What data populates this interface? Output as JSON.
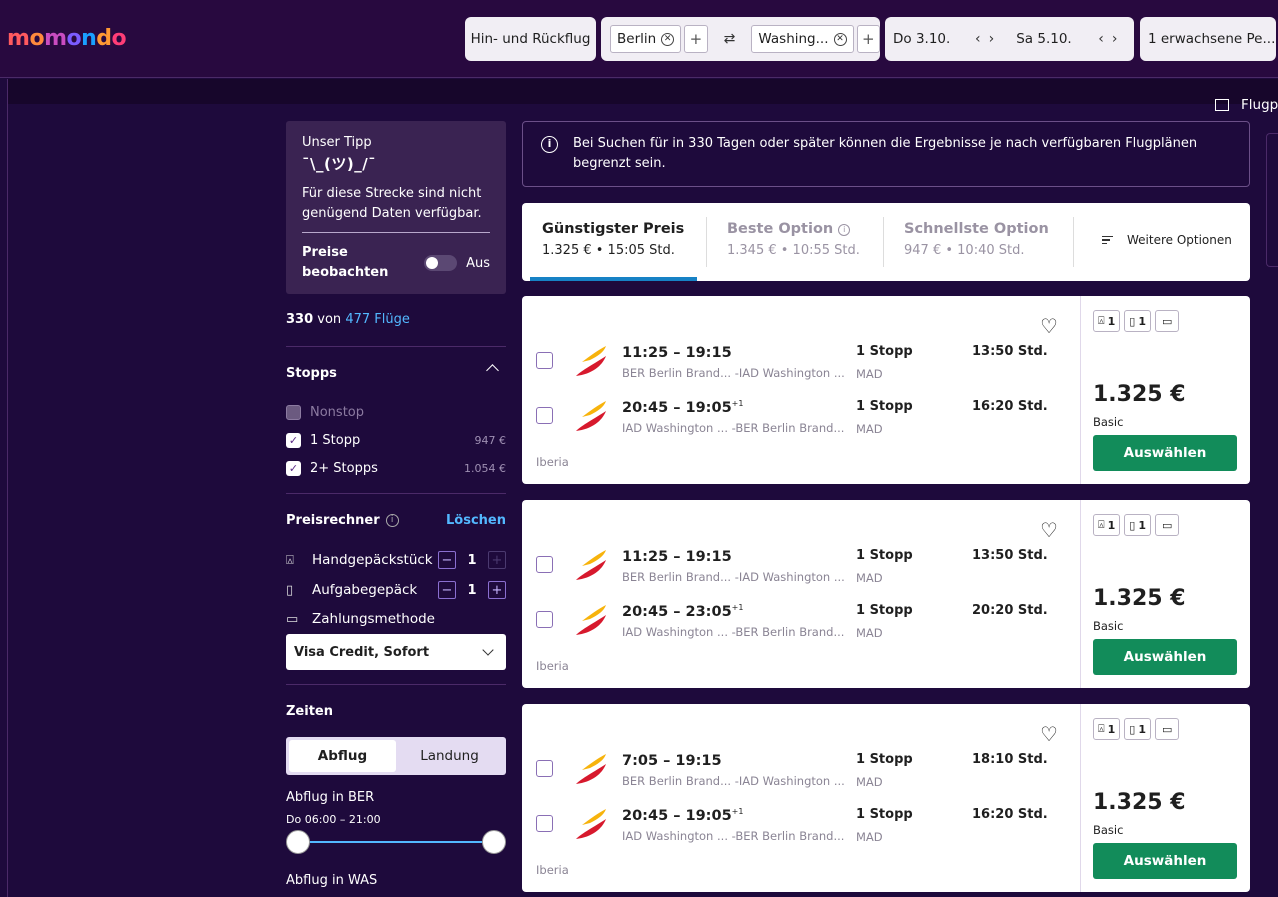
{
  "brand": {
    "logo_text": "momondo",
    "logo_colors": [
      "#ff5a5f",
      "#ff8a3d",
      "#c94cc0",
      "#7b5cff",
      "#1aa0ff",
      "#ff9933",
      "#ff3d77"
    ]
  },
  "search": {
    "trip_type": "Hin- und Rückflug",
    "origin": "Berlin",
    "destination": "Washing...",
    "swap_icon": "⇄",
    "date_out": "Do 3.10.",
    "date_back": "Sa 5.10.",
    "passengers": "1 erwachsene Pe..."
  },
  "side_link": "Flugp",
  "tip": {
    "title": "Unser Tipp",
    "shrug": "¯\\_(ツ)_/¯",
    "text": "Für diese Strecke sind nicht genügend Daten verfügbar.",
    "watch_label": "Preise beobachten",
    "toggle_state": "Aus"
  },
  "results_count": {
    "shown": "330",
    "of": "von",
    "total": "477 Flüge"
  },
  "stops": {
    "heading": "Stopps",
    "options": [
      {
        "label": "Nonstop",
        "price": "",
        "checked": false,
        "disabled": true
      },
      {
        "label": "1 Stopp",
        "price": "947 €",
        "checked": true,
        "disabled": false
      },
      {
        "label": "2+ Stopps",
        "price": "1.054 €",
        "checked": true,
        "disabled": false
      }
    ]
  },
  "price_calc": {
    "heading": "Preisrechner",
    "clear": "Löschen",
    "carry_on_label": "Handgepäckstück",
    "carry_on_value": "1",
    "checked_label": "Aufgabegepäck",
    "checked_value": "1",
    "payment_label": "Zahlungsmethode",
    "payment_value": "Visa Credit, Sofort"
  },
  "times": {
    "heading": "Zeiten",
    "tab_departure": "Abflug",
    "tab_arrival": "Landung",
    "dep_ber_label": "Abflug in BER",
    "dep_ber_range": "Do 06:00 – 21:00",
    "dep_was_label": "Abflug in WAS"
  },
  "notice": "Bei Suchen für in 330 Tagen oder später können die Ergebnisse je nach verfügbaren Flugplänen begrenzt sein.",
  "sort": {
    "cheapest_label": "Günstigster Preis",
    "cheapest_value": "1.325 € • 15:05 Std.",
    "best_label": "Beste Option",
    "best_value": "1.345 € • 10:55 Std.",
    "fastest_label": "Schnellste Option",
    "fastest_value": "947 € • 10:40 Std.",
    "more_label": "Weitere Optionen"
  },
  "results": [
    {
      "legs": [
        {
          "times": "11:25 – 19:15",
          "plus": "",
          "route": "BER Berlin Brand... -IAD Washington ...",
          "stops": "1 Stopp",
          "via": "MAD",
          "duration": "13:50 Std."
        },
        {
          "times": "20:45 – 19:05",
          "plus": "+1",
          "route": "IAD Washington ... -BER Berlin Brand...",
          "stops": "1 Stopp",
          "via": "MAD",
          "duration": "16:20 Std."
        }
      ],
      "airline": "Iberia",
      "carry_on": "1",
      "checked": "1",
      "price": "1.325 €",
      "fare": "Basic",
      "cta": "Auswählen"
    },
    {
      "legs": [
        {
          "times": "11:25 – 19:15",
          "plus": "",
          "route": "BER Berlin Brand... -IAD Washington ...",
          "stops": "1 Stopp",
          "via": "MAD",
          "duration": "13:50 Std."
        },
        {
          "times": "20:45 – 23:05",
          "plus": "+1",
          "route": "IAD Washington ... -BER Berlin Brand...",
          "stops": "1 Stopp",
          "via": "MAD",
          "duration": "20:20 Std."
        }
      ],
      "airline": "Iberia",
      "carry_on": "1",
      "checked": "1",
      "price": "1.325 €",
      "fare": "Basic",
      "cta": "Auswählen"
    },
    {
      "legs": [
        {
          "times": "7:05 – 19:15",
          "plus": "",
          "route": "BER Berlin Brand... -IAD Washington ...",
          "stops": "1 Stopp",
          "via": "MAD",
          "duration": "18:10 Std."
        },
        {
          "times": "20:45 – 19:05",
          "plus": "+1",
          "route": "IAD Washington ... -BER Berlin Brand...",
          "stops": "1 Stopp",
          "via": "MAD",
          "duration": "16:20 Std."
        }
      ],
      "airline": "Iberia",
      "carry_on": "1",
      "checked": "1",
      "price": "1.325 €",
      "fare": "Basic",
      "cta": "Auswählen"
    }
  ],
  "colors": {
    "bg": "#1e0a3c",
    "accent_blue": "#1782c5",
    "cta_green": "#128c5a",
    "link": "#53b8ff"
  }
}
